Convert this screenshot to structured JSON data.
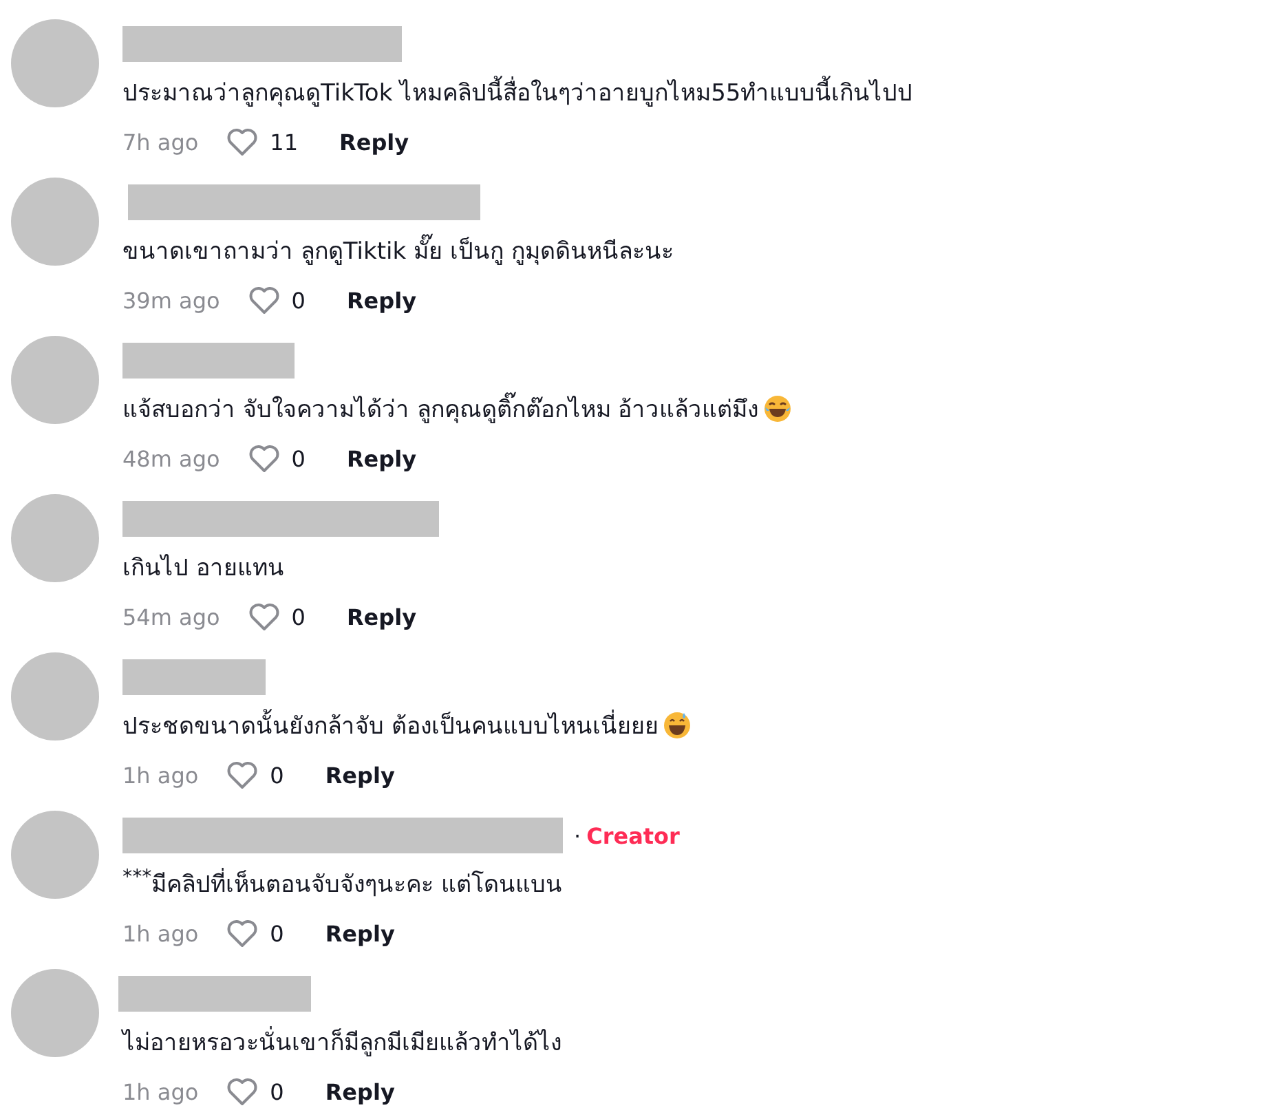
{
  "comments": [
    {
      "text": "ประมาณว่าลูกคุณดูTikTok ไหมคลิปนี้สื่อในๆว่าอายบูกไหม55ทำแบบนี้เกินไปป",
      "time": "7h ago",
      "likes": "11",
      "reply": "Reply"
    },
    {
      "text": "ขนาดเขาถามว่า ลูกดูTiktik มั๊ย เป็นกู กูมุดดินหนีละนะ",
      "time": "39m ago",
      "likes": "0",
      "reply": "Reply"
    },
    {
      "text": "แจ้สบอกว่า จับใจความได้ว่า ลูกคุณดูติ๊กต๊อกไหม อ้าวแล้วแต่มึง",
      "kind": "laugh-emoji",
      "time": "48m ago",
      "likes": "0",
      "reply": "Reply"
    },
    {
      "text": "เกินไป อายแทน",
      "time": "54m ago",
      "likes": "0",
      "reply": "Reply"
    },
    {
      "text": "ประชดขนาดนั้นยังกล้าจับ ต้องเป็นคนแบบไหนเนี่ยยย",
      "kind": "sweat-emoji",
      "time": "1h ago",
      "likes": "0",
      "reply": "Reply"
    },
    {
      "separator": "·",
      "badge": "Creator",
      "text": "$^{***}$มีคลิปที่เห็นตอนจับจังๆนะคะ แต่โดนแบน",
      "time": "1h ago",
      "likes": "0",
      "reply": "Reply"
    },
    {
      "text": "ไม่อายหรอวะนั่นเขาก็มีลูกมีเมียแล้วทำได้ไง",
      "time": "1h ago",
      "likes": "0",
      "reply": "Reply"
    }
  ]
}
